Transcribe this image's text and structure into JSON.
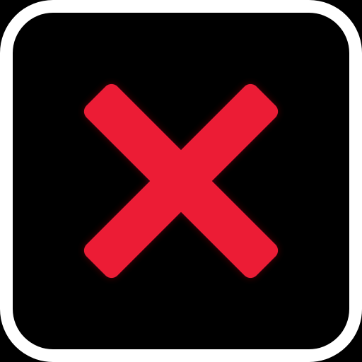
{
  "icon": {
    "name": "close-icon",
    "background_color": "#000000",
    "border_color": "#ffffff",
    "glyph_color": "#ec1b35",
    "glyph_shadow_color": "#5a0a12"
  }
}
